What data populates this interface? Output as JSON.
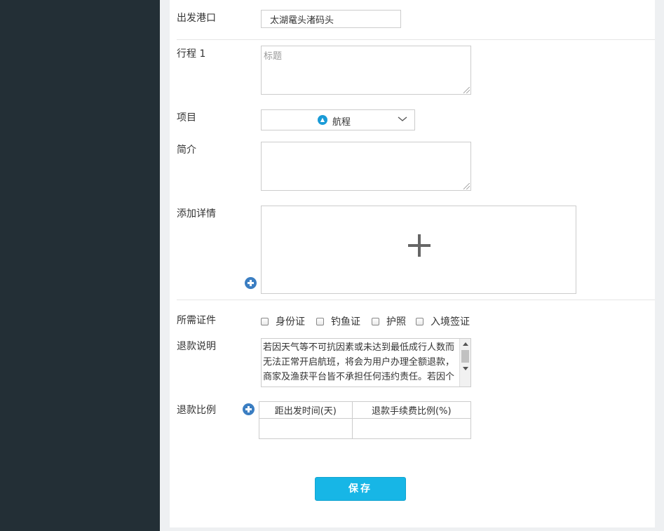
{
  "form": {
    "departure_port": {
      "label": "出发港口",
      "value": "太湖鼋头渚码头"
    },
    "itinerary": {
      "label": "行程 1",
      "placeholder": "标题"
    },
    "project": {
      "label": "项目",
      "value": "航程",
      "icon": "boat-icon"
    },
    "intro": {
      "label": "简介",
      "value": ""
    },
    "details": {
      "label": "添加详情"
    },
    "documents": {
      "label": "所需证件",
      "options": [
        "身份证",
        "钓鱼证",
        "护照",
        "入境签证"
      ]
    },
    "refund_note": {
      "label": "退款说明",
      "text": "若因天气等不可抗因素或未达到最低成行人数而无法正常开启航班，将会为用户办理全额退款，商家及渔获平台皆不承担任何违约责任。若因个人原因需要退票，将依照下"
    },
    "refund_ratio": {
      "label": "退款比例",
      "columns": [
        "距出发时间(天)",
        "退款手续费比例(%)"
      ]
    },
    "save_label": "保存"
  },
  "colors": {
    "sidebar": "#232f36",
    "save_button": "#17b6e6",
    "add_icon": "#3b7ec2"
  }
}
